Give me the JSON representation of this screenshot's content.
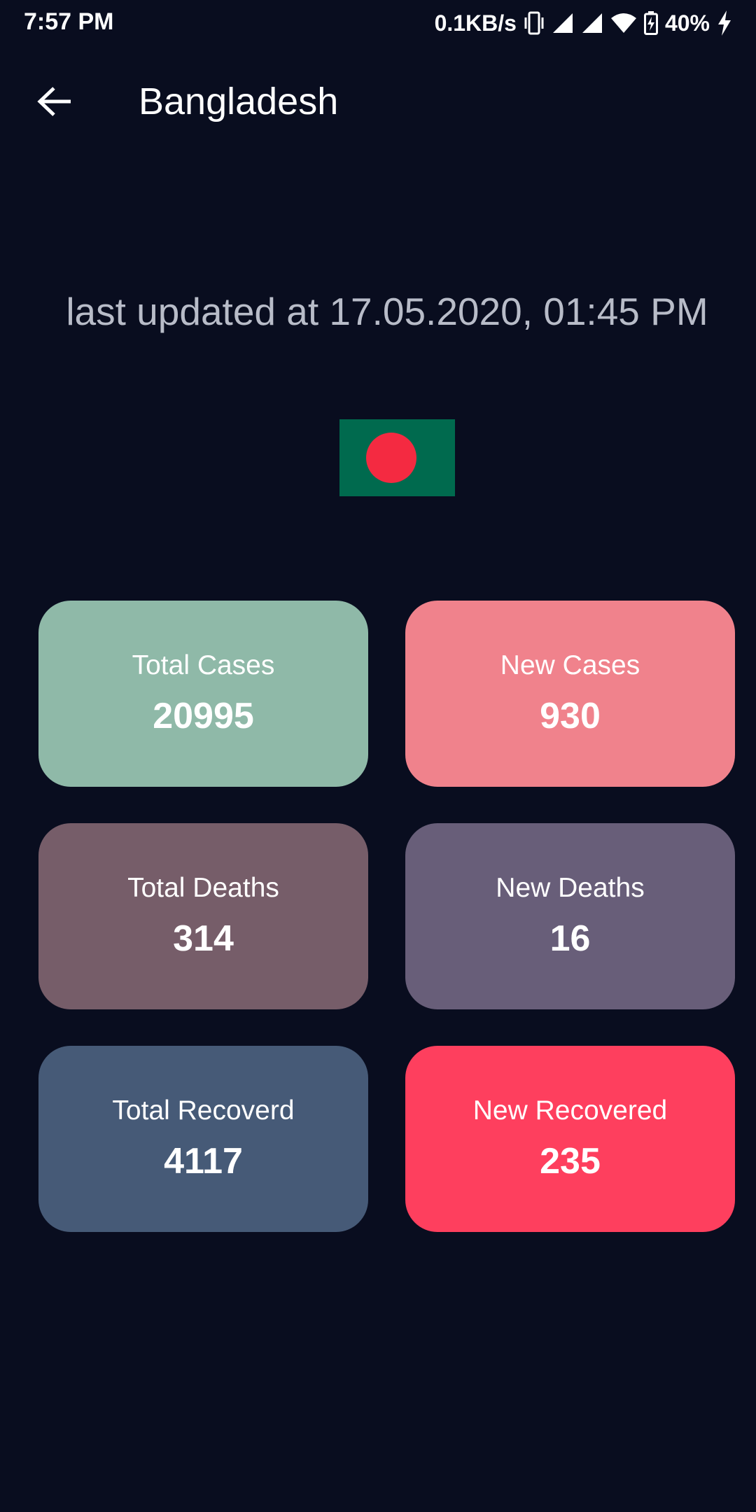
{
  "status_bar": {
    "time": "7:57 PM",
    "net_speed": "0.1KB/s",
    "battery": "40%"
  },
  "header": {
    "title": "Bangladesh",
    "back_icon": "arrow-left-icon"
  },
  "updated_text": "last updated at 17.05.2020, 01:45 PM",
  "flag": {
    "icon": "bangladesh-flag",
    "field_color": "#006a4e",
    "disc_color": "#f42a41"
  },
  "stats": [
    {
      "label": "Total Cases",
      "value": "20995",
      "color": "#8fb9a8"
    },
    {
      "label": "New Cases",
      "value": "930",
      "color": "#f0828c"
    },
    {
      "label": "Total Deaths",
      "value": "314",
      "color": "#765d69"
    },
    {
      "label": "New Deaths",
      "value": "16",
      "color": "#685e79"
    },
    {
      "label": "Total Recoverd",
      "value": "4117",
      "color": "#465a77"
    },
    {
      "label": "New Recovered",
      "value": "235",
      "color": "#fe3f5e"
    }
  ]
}
